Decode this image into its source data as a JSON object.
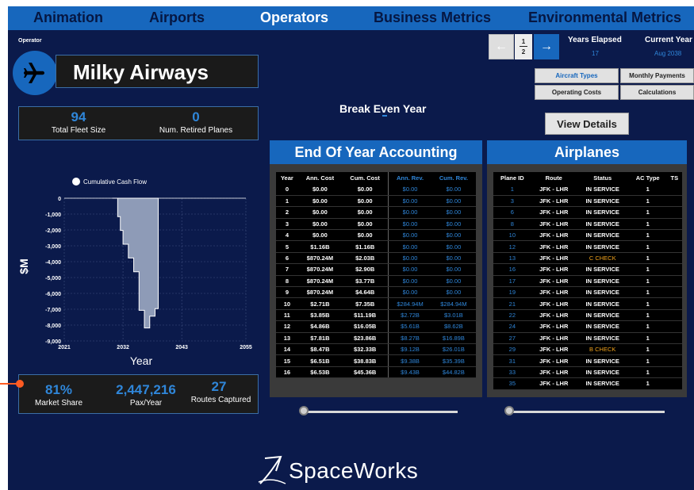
{
  "nav": {
    "tabs": [
      {
        "label": "Animation"
      },
      {
        "label": "Airports"
      },
      {
        "label": "Operators"
      },
      {
        "label": "Business Metrics"
      },
      {
        "label": "Environmental Metrics"
      }
    ],
    "active": "Operators"
  },
  "operator": {
    "label": "Operator",
    "name": "Milky Airways",
    "icon": "airplane-icon"
  },
  "fleet": {
    "total_fleet_size": "94",
    "total_fleet_label": "Total Fleet Size",
    "retired": "0",
    "retired_label": "Num. Retired Planes"
  },
  "break_even": {
    "label": "Break Even Year",
    "value": "-"
  },
  "pager": {
    "prev_icon": "left-arrow-icon",
    "next_icon": "right-arrow-icon",
    "fraction_num": "1",
    "fraction_den": "2"
  },
  "years": {
    "elapsed_label": "Years Elapsed",
    "elapsed_value": "17",
    "current_label": "Current Year",
    "current_value": "Aug 2038"
  },
  "buttons": {
    "aircraft_types": "Aircraft Types",
    "monthly_payments": "Monthly Payments",
    "operating_costs": "Operating Costs",
    "calculations": "Calculations",
    "view_details": "View Details"
  },
  "accounting": {
    "title": "End Of Year Accounting",
    "headers": [
      "Year",
      "Ann. Cost",
      "Cum. Cost",
      "Ann. Rev.",
      "Cum. Rev."
    ],
    "rows": [
      [
        "0",
        "$0.00",
        "$0.00",
        "$0.00",
        "$0.00"
      ],
      [
        "1",
        "$0.00",
        "$0.00",
        "$0.00",
        "$0.00"
      ],
      [
        "2",
        "$0.00",
        "$0.00",
        "$0.00",
        "$0.00"
      ],
      [
        "3",
        "$0.00",
        "$0.00",
        "$0.00",
        "$0.00"
      ],
      [
        "4",
        "$0.00",
        "$0.00",
        "$0.00",
        "$0.00"
      ],
      [
        "5",
        "$1.16B",
        "$1.16B",
        "$0.00",
        "$0.00"
      ],
      [
        "6",
        "$870.24M",
        "$2.03B",
        "$0.00",
        "$0.00"
      ],
      [
        "7",
        "$870.24M",
        "$2.90B",
        "$0.00",
        "$0.00"
      ],
      [
        "8",
        "$870.24M",
        "$3.77B",
        "$0.00",
        "$0.00"
      ],
      [
        "9",
        "$870.24M",
        "$4.64B",
        "$0.00",
        "$0.00"
      ],
      [
        "10",
        "$2.71B",
        "$7.35B",
        "$284.94M",
        "$284.94M"
      ],
      [
        "11",
        "$3.85B",
        "$11.19B",
        "$2.72B",
        "$3.01B"
      ],
      [
        "12",
        "$4.86B",
        "$16.05B",
        "$5.61B",
        "$8.62B"
      ],
      [
        "13",
        "$7.81B",
        "$23.86B",
        "$8.27B",
        "$16.89B"
      ],
      [
        "14",
        "$8.47B",
        "$32.33B",
        "$9.12B",
        "$26.01B"
      ],
      [
        "15",
        "$6.51B",
        "$38.83B",
        "$9.38B",
        "$35.39B"
      ],
      [
        "16",
        "$6.53B",
        "$45.36B",
        "$9.43B",
        "$44.82B"
      ]
    ]
  },
  "airplanes": {
    "title": "Airplanes",
    "headers": [
      "Plane ID",
      "Route",
      "Status",
      "AC Type",
      "TS"
    ],
    "rows": [
      [
        "1",
        "JFK - LHR",
        "IN SERVICE",
        "1",
        ""
      ],
      [
        "3",
        "JFK - LHR",
        "IN SERVICE",
        "1",
        ""
      ],
      [
        "6",
        "JFK - LHR",
        "IN SERVICE",
        "1",
        ""
      ],
      [
        "8",
        "JFK - LHR",
        "IN SERVICE",
        "1",
        ""
      ],
      [
        "10",
        "JFK - LHR",
        "IN SERVICE",
        "1",
        ""
      ],
      [
        "12",
        "JFK - LHR",
        "IN SERVICE",
        "1",
        ""
      ],
      [
        "13",
        "JFK - LHR",
        "C CHECK",
        "1",
        ""
      ],
      [
        "16",
        "JFK - LHR",
        "IN SERVICE",
        "1",
        ""
      ],
      [
        "17",
        "JFK - LHR",
        "IN SERVICE",
        "1",
        ""
      ],
      [
        "19",
        "JFK - LHR",
        "IN SERVICE",
        "1",
        ""
      ],
      [
        "21",
        "JFK - LHR",
        "IN SERVICE",
        "1",
        ""
      ],
      [
        "22",
        "JFK - LHR",
        "IN SERVICE",
        "1",
        ""
      ],
      [
        "24",
        "JFK - LHR",
        "IN SERVICE",
        "1",
        ""
      ],
      [
        "27",
        "JFK - LHR",
        "IN SERVICE",
        "1",
        ""
      ],
      [
        "29",
        "JFK - LHR",
        "B CHECK",
        "1",
        ""
      ],
      [
        "31",
        "JFK - LHR",
        "IN SERVICE",
        "1",
        ""
      ],
      [
        "33",
        "JFK - LHR",
        "IN SERVICE",
        "1",
        ""
      ],
      [
        "35",
        "JFK - LHR",
        "IN SERVICE",
        "1",
        ""
      ]
    ]
  },
  "market": {
    "share": "81%",
    "share_label": "Market Share",
    "pax": "2,447,216",
    "pax_label": "Pax/Year",
    "routes": "27",
    "routes_label": "Routes Captured"
  },
  "logo": {
    "text": "SpaceWorks"
  },
  "colors": {
    "background": "#0b1a4b",
    "accent": "#1767bd",
    "value_blue": "#2f86d9",
    "warning": "#f0a21c",
    "pointer": "#ff5b22"
  },
  "chart_data": {
    "type": "area",
    "legend": [
      "Cumulative Cash Flow"
    ],
    "legend_position": "top",
    "xlabel": "Year",
    "ylabel": "$M",
    "xlim": [
      2021,
      2055
    ],
    "ylim": [
      -9000,
      0
    ],
    "xticks": [
      2021,
      2032,
      2043,
      2055
    ],
    "yticks": [
      0,
      -1000,
      -2000,
      -3000,
      -4000,
      -5000,
      -6000,
      -7000,
      -8000,
      -9000
    ],
    "ytick_labels": [
      "0",
      "-1,000",
      "-2,000",
      "-3,000",
      "-4,000",
      "-5,000",
      "-6,000",
      "-7,000",
      "-8,000",
      "-9,000"
    ],
    "grid": true,
    "series": [
      {
        "name": "Cumulative Cash Flow",
        "x": [
          2030,
          2031,
          2031.5,
          2032,
          2033,
          2034,
          2035,
          2036,
          2037,
          2038,
          2038.6
        ],
        "values": [
          0,
          -1160,
          -2030,
          -2900,
          -3770,
          -4640,
          -7070,
          -8180,
          -7440,
          -6960,
          -6440
        ]
      }
    ]
  }
}
